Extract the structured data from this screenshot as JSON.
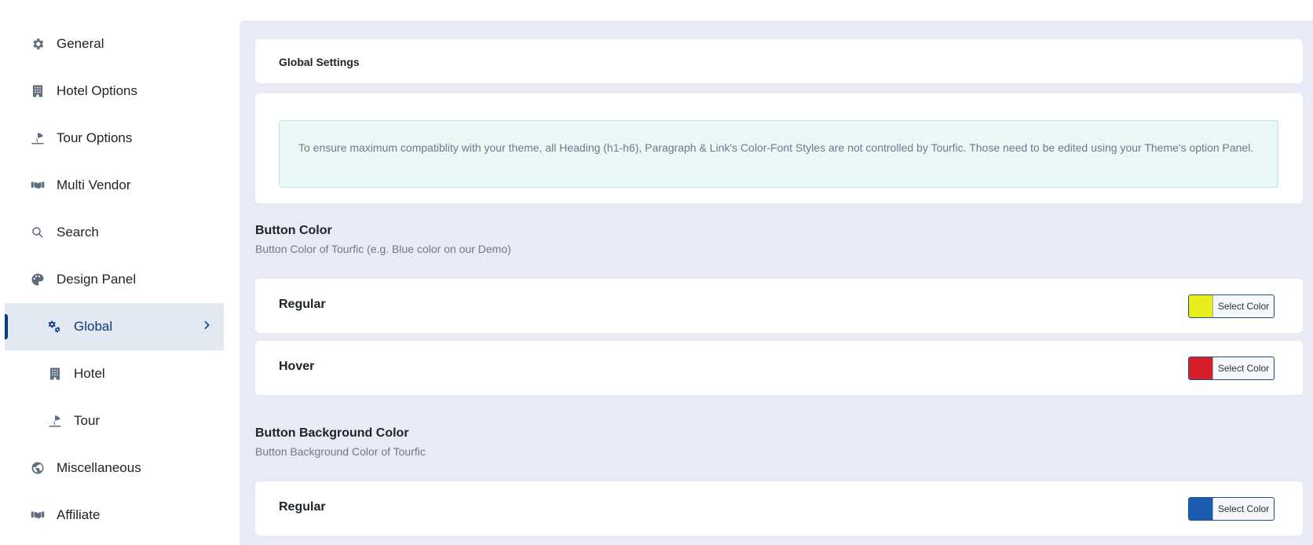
{
  "sidebar": {
    "items": [
      {
        "label": "General",
        "icon": "gear-icon"
      },
      {
        "label": "Hotel Options",
        "icon": "building-icon"
      },
      {
        "label": "Tour Options",
        "icon": "umbrella-beach-icon"
      },
      {
        "label": "Multi Vendor",
        "icon": "handshake-icon"
      },
      {
        "label": "Search",
        "icon": "search-icon"
      },
      {
        "label": "Design Panel",
        "icon": "palette-icon"
      },
      {
        "label": "Global",
        "icon": "cogs-icon"
      },
      {
        "label": "Hotel",
        "icon": "building-icon"
      },
      {
        "label": "Tour",
        "icon": "umbrella-beach-icon"
      },
      {
        "label": "Miscellaneous",
        "icon": "globe-icon"
      },
      {
        "label": "Affiliate",
        "icon": "handshake-icon"
      }
    ]
  },
  "main": {
    "header_title": "Global Settings",
    "notice": "To ensure maximum compatiblity with your theme, all Heading (h1-h6), Paragraph & Link's Color-Font Styles are not controlled by Tourfic. Those need to be edited using your Theme's option Panel.",
    "sections": [
      {
        "title": "Button Color",
        "description": "Button Color of Tourfic (e.g. Blue color on our Demo)",
        "rows": [
          {
            "label": "Regular",
            "color": "#e8ee1e",
            "button_label": "Select Color"
          },
          {
            "label": "Hover",
            "color": "#d81e28",
            "button_label": "Select Color"
          }
        ]
      },
      {
        "title": "Button Background Color",
        "description": "Button Background Color of Tourfic",
        "rows": [
          {
            "label": "Regular",
            "color": "#1b5bb0",
            "button_label": "Select Color"
          }
        ]
      }
    ]
  }
}
